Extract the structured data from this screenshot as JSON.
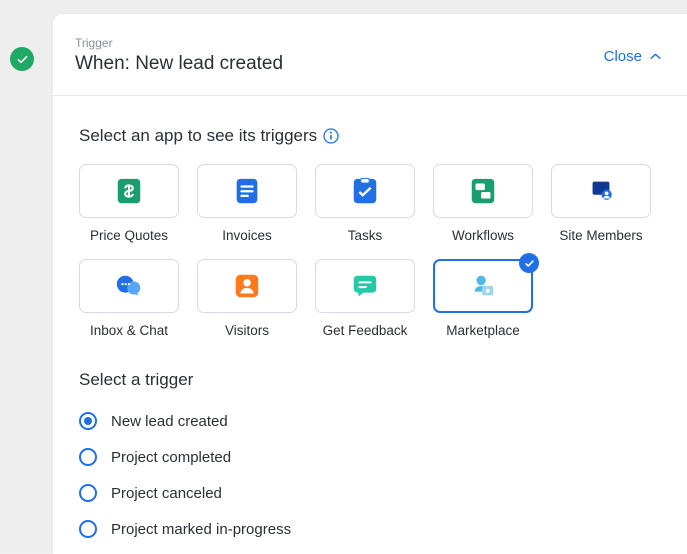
{
  "header": {
    "section_label": "Trigger",
    "title": "When: New lead created",
    "close_label": "Close"
  },
  "section_apps_title": "Select an app to see its triggers",
  "apps": [
    {
      "id": "price-quotes",
      "label": "Price Quotes",
      "selected": false
    },
    {
      "id": "invoices",
      "label": "Invoices",
      "selected": false
    },
    {
      "id": "tasks",
      "label": "Tasks",
      "selected": false
    },
    {
      "id": "workflows",
      "label": "Workflows",
      "selected": false
    },
    {
      "id": "site-members",
      "label": "Site Members",
      "selected": false
    },
    {
      "id": "inbox-chat",
      "label": "Inbox & Chat",
      "selected": false
    },
    {
      "id": "visitors",
      "label": "Visitors",
      "selected": false
    },
    {
      "id": "get-feedback",
      "label": "Get Feedback",
      "selected": false
    },
    {
      "id": "marketplace",
      "label": "Marketplace",
      "selected": true
    }
  ],
  "section_trigger_title": "Select a trigger",
  "triggers": [
    {
      "label": "New lead created",
      "selected": true
    },
    {
      "label": "Project completed",
      "selected": false
    },
    {
      "label": "Project canceled",
      "selected": false
    },
    {
      "label": "Project marked in-progress",
      "selected": false
    }
  ],
  "colors": {
    "accent": "#206fe6",
    "success": "#1fa866"
  }
}
